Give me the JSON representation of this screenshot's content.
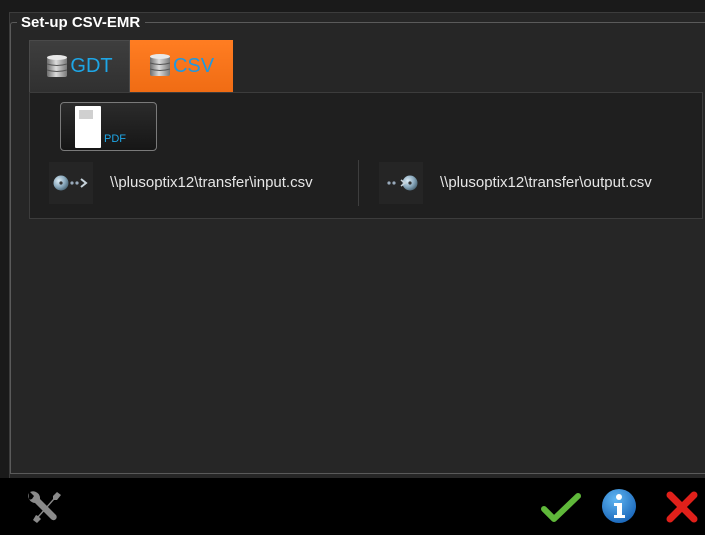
{
  "panel": {
    "title": "Set-up CSV-EMR"
  },
  "tabs": [
    {
      "label": "GDT",
      "icon": "database-icon",
      "active": false
    },
    {
      "label": "CSV",
      "icon": "database-icon",
      "active": true
    }
  ],
  "pdf_button": {
    "label": "PDF",
    "icon": "pdf-document-icon"
  },
  "input_path": {
    "icon": "import-disc-icon",
    "value": "\\\\plusoptix12\\transfer\\input.csv"
  },
  "output_path": {
    "icon": "export-disc-icon",
    "value": "\\\\plusoptix12\\transfer\\output.csv"
  },
  "bottom_bar": {
    "settings_icon": "tools-icon",
    "confirm_icon": "checkmark-icon",
    "info_icon": "info-icon",
    "cancel_icon": "close-icon"
  },
  "colors": {
    "accent_orange": "#f57320",
    "accent_blue": "#1ea6e6",
    "confirm_green": "#5fb83a",
    "cancel_red": "#e0201a"
  }
}
